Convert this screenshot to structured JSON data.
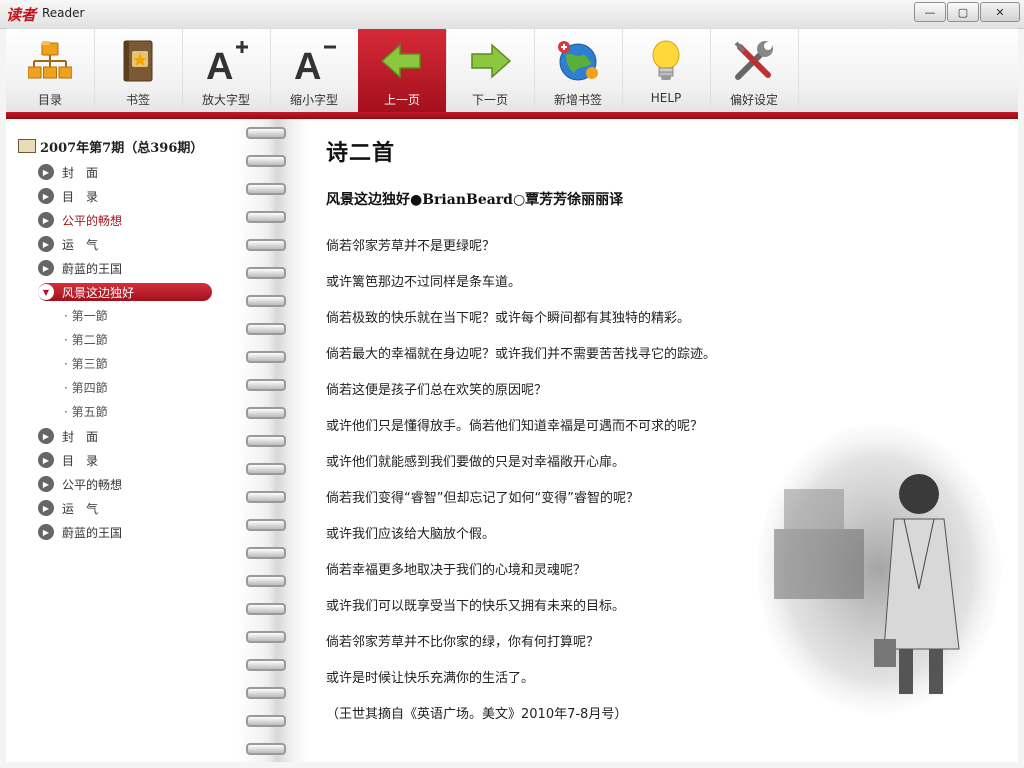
{
  "window": {
    "logo": "读者",
    "title": "Reader",
    "controls": [
      "—",
      "▢",
      "✕"
    ]
  },
  "toolbar": [
    {
      "label": "目录",
      "icon": "sitemap-icon"
    },
    {
      "label": "书签",
      "icon": "bookmark-book-icon"
    },
    {
      "label": "放大字型",
      "icon": "font-increase-icon"
    },
    {
      "label": "缩小字型",
      "icon": "font-decrease-icon"
    },
    {
      "label": "上一页",
      "icon": "arrow-left-icon",
      "active": true
    },
    {
      "label": "下一页",
      "icon": "arrow-right-icon"
    },
    {
      "label": "新增书签",
      "icon": "globe-bookmark-icon"
    },
    {
      "label": "HELP",
      "icon": "lightbulb-icon"
    },
    {
      "label": "偏好设定",
      "icon": "tools-icon"
    }
  ],
  "sidebar": {
    "root": "2007年第7期（总396期）",
    "items": [
      {
        "label": "封　面",
        "style": "normal"
      },
      {
        "label": "目　录",
        "style": "normal"
      },
      {
        "label": "公平的畅想",
        "style": "red"
      },
      {
        "label": "运　气",
        "style": "normal"
      },
      {
        "label": "蔚蓝的王国",
        "style": "normal"
      },
      {
        "label": "风景这边独好",
        "style": "selected"
      }
    ],
    "subitems": [
      "· 第一節",
      "· 第二節",
      "· 第三節",
      "· 第四節",
      "· 第五節"
    ],
    "items_after": [
      {
        "label": "封　面"
      },
      {
        "label": "目　录"
      },
      {
        "label": "公平的畅想"
      },
      {
        "label": "运　气"
      },
      {
        "label": "蔚蓝的王国"
      }
    ]
  },
  "article": {
    "title": "诗二首",
    "subtitle": "风景这边独好●BrianBeard○覃芳芳徐丽丽译",
    "paragraphs": [
      "倘若邻家芳草并不是更绿呢？",
      "或许篱笆那边不过同样是条车道。",
      "倘若极致的快乐就在当下呢？或许每个瞬间都有其独特的精彩。",
      "倘若最大的幸福就在身边呢？或许我们并不需要苦苦找寻它的踪迹。",
      "倘若这便是孩子们总在欢笑的原因呢？",
      "或许他们只是懂得放手。倘若他们知道幸福是可遇而不可求的呢？",
      "或许他们就能感到我们要做的只是对幸福敞开心扉。",
      "倘若我们变得“睿智”但却忘记了如何“变得”睿智的呢？",
      "或许我们应该给大脑放个假。",
      "倘若幸福更多地取决于我们的心境和灵魂呢？",
      "或许我们可以既享受当下的快乐又拥有未来的目标。",
      "倘若邻家芳草并不比你家的绿，你有何打算呢？",
      "或许是时候让快乐充满你的生活了。",
      "（王世其摘自《英语广场。美文》2010年7-8月号）"
    ]
  },
  "colors": {
    "accent": "#c0141e",
    "sidebar_red_text": "#a0141c"
  }
}
